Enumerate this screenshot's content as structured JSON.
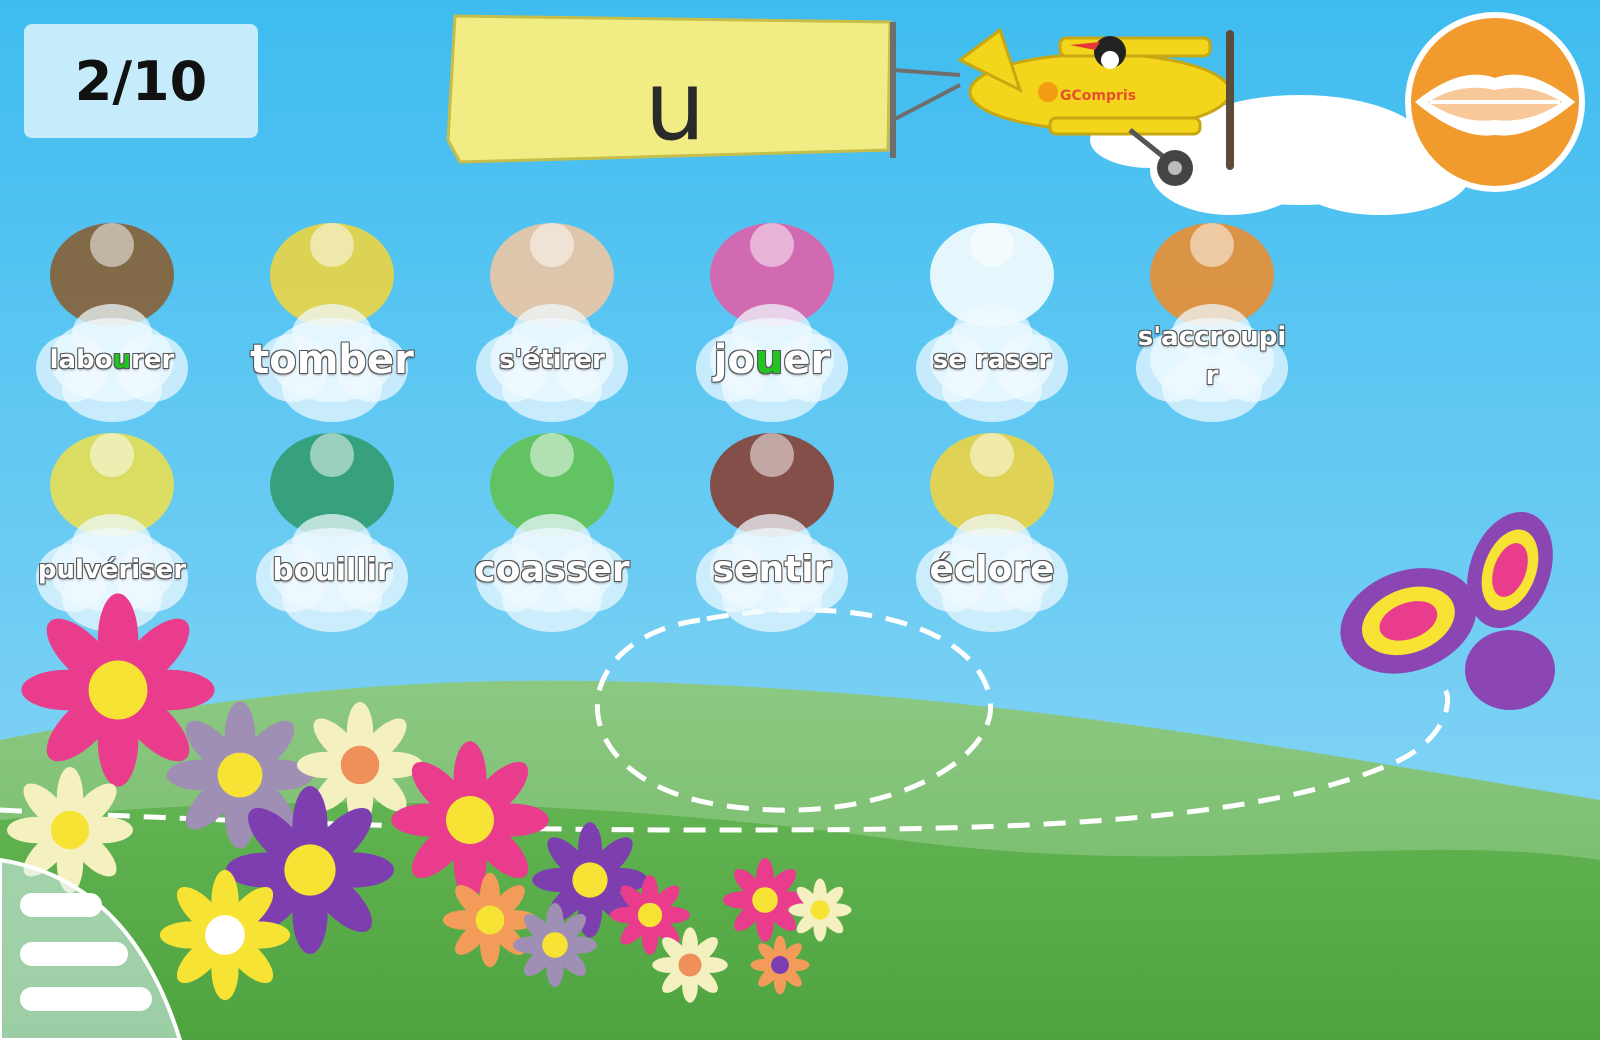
{
  "score": {
    "text": "2/10"
  },
  "target_sound": {
    "letter": "u"
  },
  "plane": {
    "logo_text": "GCompris"
  },
  "words": [
    {
      "id": "labourer",
      "pre": "labo",
      "hl": "u",
      "post": "rer",
      "picture": "farmer-plowing-with-horse"
    },
    {
      "id": "tomber",
      "pre": "tomber",
      "hl": "",
      "post": "",
      "picture": "falling-blocks"
    },
    {
      "id": "s-etirer",
      "pre": "s'étirer",
      "hl": "",
      "post": "",
      "picture": "girl-stretching"
    },
    {
      "id": "jouer",
      "pre": "jo",
      "hl": "u",
      "post": "er",
      "picture": "boy-on-slide"
    },
    {
      "id": "se-raser",
      "pre": "se raser",
      "hl": "",
      "post": "",
      "picture": "sheep-being-sheared"
    },
    {
      "id": "s-accroupir",
      "line1": "s'accroupi",
      "line2": "r",
      "picture": "boy-crouching"
    },
    {
      "id": "pulveriser",
      "pre": "pulvériser",
      "hl": "",
      "post": "",
      "picture": "spray-bottle"
    },
    {
      "id": "bouillir",
      "pre": "bouillir",
      "hl": "",
      "post": "",
      "picture": "boiling-pot"
    },
    {
      "id": "coasser",
      "pre": "coasser",
      "hl": "",
      "post": "",
      "picture": "croaking-frog"
    },
    {
      "id": "sentir",
      "pre": "sentir",
      "hl": "",
      "post": "",
      "picture": "girl-smelling-flower"
    },
    {
      "id": "eclore",
      "pre": "éclore",
      "hl": "",
      "post": "",
      "picture": "chick-hatching"
    }
  ],
  "icons": {
    "repeat_sound": "lips-icon",
    "menu": "menu-icon"
  },
  "colors": {
    "sky_top": "#3fbcef",
    "sky_bottom": "#8fd8f4",
    "grass": "#5eb04c",
    "banner": "#f2ec85",
    "lips_button": "#f19a2e",
    "highlight": "#22c322"
  }
}
